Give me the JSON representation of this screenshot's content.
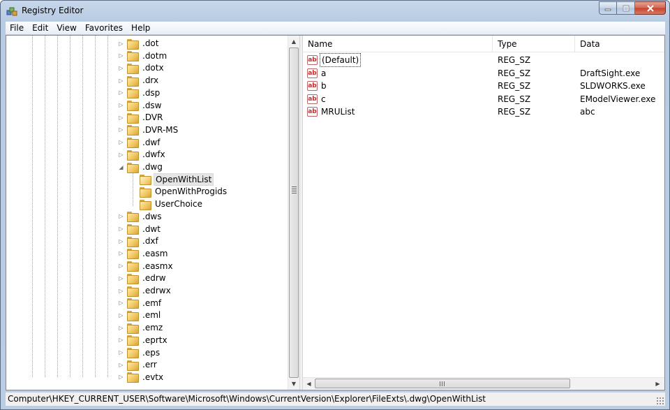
{
  "window": {
    "title": "Registry Editor",
    "controls": {
      "minimize": "minimize",
      "maximize": "maximize",
      "close": "close"
    }
  },
  "menu": [
    "File",
    "Edit",
    "View",
    "Favorites",
    "Help"
  ],
  "tree": {
    "items": [
      {
        "label": ".dot",
        "expander": "▷",
        "depth": 0
      },
      {
        "label": ".dotm",
        "expander": "▷",
        "depth": 0
      },
      {
        "label": ".dotx",
        "expander": "▷",
        "depth": 0
      },
      {
        "label": ".drx",
        "expander": "▷",
        "depth": 0
      },
      {
        "label": ".dsp",
        "expander": "▷",
        "depth": 0
      },
      {
        "label": ".dsw",
        "expander": "▷",
        "depth": 0
      },
      {
        "label": ".DVR",
        "expander": "▷",
        "depth": 0
      },
      {
        "label": ".DVR-MS",
        "expander": "▷",
        "depth": 0
      },
      {
        "label": ".dwf",
        "expander": "▷",
        "depth": 0
      },
      {
        "label": ".dwfx",
        "expander": "▷",
        "depth": 0
      },
      {
        "label": ".dwg",
        "expander": "◢",
        "depth": 0,
        "expanded": true
      },
      {
        "label": "OpenWithList",
        "expander": "",
        "depth": 1,
        "selected": true
      },
      {
        "label": "OpenWithProgids",
        "expander": "",
        "depth": 1
      },
      {
        "label": "UserChoice",
        "expander": "",
        "depth": 1
      },
      {
        "label": ".dws",
        "expander": "▷",
        "depth": 0
      },
      {
        "label": ".dwt",
        "expander": "▷",
        "depth": 0
      },
      {
        "label": ".dxf",
        "expander": "▷",
        "depth": 0
      },
      {
        "label": ".easm",
        "expander": "▷",
        "depth": 0
      },
      {
        "label": ".easmx",
        "expander": "▷",
        "depth": 0
      },
      {
        "label": ".edrw",
        "expander": "▷",
        "depth": 0
      },
      {
        "label": ".edrwx",
        "expander": "▷",
        "depth": 0
      },
      {
        "label": ".emf",
        "expander": "▷",
        "depth": 0
      },
      {
        "label": ".eml",
        "expander": "▷",
        "depth": 0
      },
      {
        "label": ".emz",
        "expander": "▷",
        "depth": 0
      },
      {
        "label": ".eprtx",
        "expander": "▷",
        "depth": 0
      },
      {
        "label": ".eps",
        "expander": "▷",
        "depth": 0
      },
      {
        "label": ".err",
        "expander": "▷",
        "depth": 0
      },
      {
        "label": ".evtx",
        "expander": "▷",
        "depth": 0
      }
    ]
  },
  "list": {
    "columns": {
      "name": "Name",
      "type": "Type",
      "data": "Data"
    },
    "rows": [
      {
        "name": "(Default)",
        "type": "REG_SZ",
        "data": "",
        "icon": "ab",
        "focused": true
      },
      {
        "name": "a",
        "type": "REG_SZ",
        "data": "DraftSight.exe",
        "icon": "ab"
      },
      {
        "name": "b",
        "type": "REG_SZ",
        "data": "SLDWORKS.exe",
        "icon": "ab"
      },
      {
        "name": "c",
        "type": "REG_SZ",
        "data": "EModelViewer.exe",
        "icon": "ab"
      },
      {
        "name": "MRUList",
        "type": "REG_SZ",
        "data": "abc",
        "icon": "ab"
      }
    ]
  },
  "statusbar": {
    "path": "Computer\\HKEY_CURRENT_USER\\Software\\Microsoft\\Windows\\CurrentVersion\\Explorer\\FileExts\\.dwg\\OpenWithList"
  },
  "colors": {
    "titlebar": "#b9cde4",
    "selection": "#e5e5e5",
    "folder": "#eec55c",
    "string_icon": "#c03030"
  }
}
